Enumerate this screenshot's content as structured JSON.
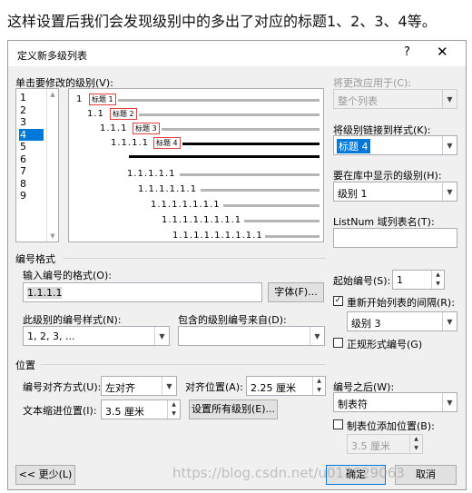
{
  "caption": "这样设置后我们会发现级别中的多出了对应的标题1、2、3、4等。",
  "dialog": {
    "title": "定义新多级列表",
    "help": "?",
    "close": "✕"
  },
  "level_list": {
    "label": "单击要修改的级别(V):",
    "items": [
      "1",
      "2",
      "3",
      "4",
      "5",
      "6",
      "7",
      "8",
      "9"
    ],
    "selected": "4"
  },
  "apply_to": {
    "label": "将更改应用于(C):",
    "value": "整个列表"
  },
  "link_style": {
    "label": "将级别链接到样式(K):",
    "value": "标题 4"
  },
  "gallery_level": {
    "label": "要在库中显示的级别(H):",
    "value": "级别 1"
  },
  "listnum": {
    "label": "ListNum 域列表名(T):",
    "value": ""
  },
  "preview": {
    "numbers": [
      "1",
      "1.1",
      "1.1.1",
      "1.1.1.1",
      "1.1.1.1.1",
      "1.1.1.1.1.1",
      "1.1.1.1.1.1.1",
      "1.1.1.1.1.1.1.1",
      "1.1.1.1.1.1.1.1.1"
    ],
    "tags": [
      "标题 1",
      "标题 2",
      "标题 3",
      "标题 4"
    ]
  },
  "number_format": {
    "section": "编号格式",
    "format_label": "输入编号的格式(O):",
    "format_value": "1.1.1.1",
    "font_button": "字体(F)...",
    "style_label": "此级别的编号样式(N):",
    "style_value": "1, 2, 3, ...",
    "include_label": "包含的级别编号来自(D):",
    "include_value": "",
    "start_label": "起始编号(S):",
    "start_value": "1",
    "restart_label": "重新开始列表的间隔(R):",
    "restart_checked": "✓",
    "restart_value": "级别 3",
    "legal_label": "正规形式编号(G)"
  },
  "position": {
    "section": "位置",
    "align_label": "编号对齐方式(U):",
    "align_value": "左对齐",
    "align_at_label": "对齐位置(A):",
    "align_at_value": "2.25 厘米",
    "indent_label": "文本缩进位置(I):",
    "indent_value": "3.5 厘米",
    "set_all_button": "设置所有级别(E)...",
    "follow_label": "编号之后(W):",
    "follow_value": "制表符",
    "tab_add_label": "制表位添加位置(B):",
    "tab_add_value": "3.5 厘米"
  },
  "buttons": {
    "less": "<< 更少(L)",
    "ok": "确定",
    "cancel": "取消"
  },
  "watermark": "https://blog.csdn.net/u013829063"
}
